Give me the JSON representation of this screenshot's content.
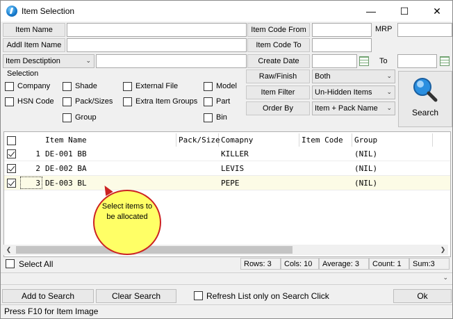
{
  "window": {
    "title": "Item Selection",
    "controls": {
      "minimize": "—",
      "maximize": "☐",
      "close": "✕"
    }
  },
  "fields": {
    "item_name_label": "Item Name",
    "addl_item_name_label": "Addl Item Name",
    "item_description_select": "Item Desctiption",
    "item_code_from_label": "Item Code From",
    "mrp_label": "MRP",
    "item_code_to_label": "Item Code To",
    "create_date_label": "Create Date",
    "to_label": "To",
    "raw_finish_label": "Raw/Finish",
    "raw_finish_value": "Both",
    "item_filter_label": "Item Filter",
    "item_filter_value": "Un-Hidden Items",
    "order_by_label": "Order By",
    "order_by_value": "Item + Pack  Name"
  },
  "selection": {
    "label": "Selection",
    "checkboxes": {
      "company": "Company",
      "shade": "Shade",
      "external_file": "External File",
      "model": "Model",
      "hsn_code": "HSN Code",
      "pack_sizes": "Pack/Sizes",
      "extra_item_groups": "Extra Item Groups",
      "part": "Part",
      "group": "Group",
      "bin": "Bin"
    }
  },
  "search_button": {
    "label": "Search",
    "icon": "magnifier-icon"
  },
  "grid": {
    "columns": [
      "Item Name",
      "Pack/Size",
      "Comapny",
      "Item Code",
      "Group"
    ],
    "rows": [
      {
        "checked": true,
        "num": "1",
        "item_name": "DE-001 BB",
        "pack_size": "",
        "company": "KILLER",
        "item_code": "",
        "group": "(NIL)"
      },
      {
        "checked": true,
        "num": "2",
        "item_name": "DE-002 BA",
        "pack_size": "",
        "company": "LEVIS",
        "item_code": "",
        "group": "(NIL)"
      },
      {
        "checked": true,
        "num": "3",
        "item_name": "DE-003 BL",
        "pack_size": "",
        "company": "PEPE",
        "item_code": "",
        "group": "(NIL)"
      }
    ]
  },
  "callout": {
    "text": "Select  items to  be allocated"
  },
  "status_bar": {
    "select_all": "Select All",
    "rows": "Rows: 3",
    "cols": "Cols: 10",
    "average": "Average: 3",
    "count": "Count: 1",
    "sum": "Sum:3"
  },
  "buttons": {
    "add_to_search": "Add to Search",
    "clear_search": "Clear Search",
    "refresh_list": "Refresh List only on Search Click",
    "ok": "Ok"
  },
  "footer": {
    "hint": "Press F10 for Item Image"
  },
  "colors": {
    "callout_fill": "#ffff66",
    "callout_border": "#cc2222",
    "active_row": "#fcfbe6"
  }
}
